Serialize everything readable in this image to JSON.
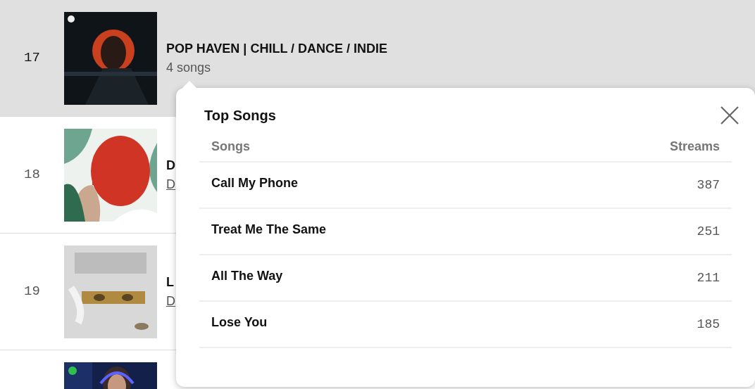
{
  "playlists": [
    {
      "rank": "17",
      "title": "POP HAVEN | CHILL / DANCE / INDIE",
      "subtitle": "4 songs",
      "linked": false,
      "selected": true
    },
    {
      "rank": "18",
      "title": "D",
      "subtitle": "D",
      "linked": true,
      "selected": false
    },
    {
      "rank": "19",
      "title": "L",
      "subtitle": "D",
      "linked": true,
      "selected": false
    },
    {
      "selected": false
    }
  ],
  "popover": {
    "title": "Top Songs",
    "columns": [
      "Songs",
      "Streams"
    ],
    "rows": [
      {
        "song": "Call My Phone",
        "streams": "387"
      },
      {
        "song": "Treat Me The Same",
        "streams": "251"
      },
      {
        "song": "All The Way",
        "streams": "211"
      },
      {
        "song": "Lose You",
        "streams": "185"
      }
    ]
  }
}
